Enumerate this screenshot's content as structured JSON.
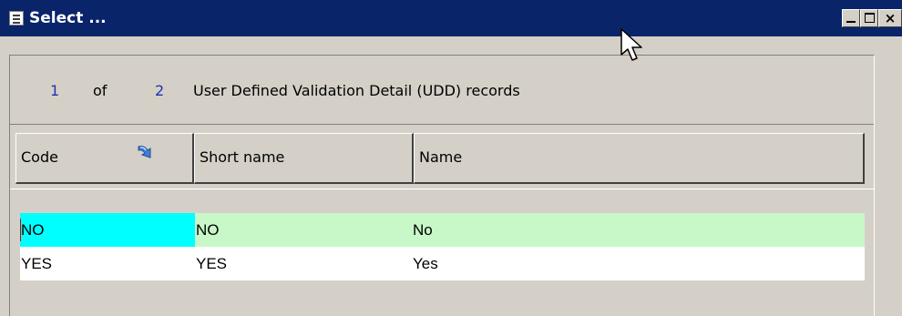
{
  "window": {
    "title": "Select ...",
    "colors": {
      "title_bar": "#0a246a",
      "face": "#d4d0c8",
      "selected_row": "#c8f8c8",
      "selected_cell": "#00ffff"
    },
    "icons": {
      "app": "app-icon",
      "minimize": "minimize-icon",
      "maximize": "maximize-icon",
      "close": "close-icon"
    },
    "close_glyph": "×"
  },
  "record_info": {
    "current": "1",
    "of_label": "of",
    "total": "2",
    "description": "User Defined Validation Detail (UDD) records"
  },
  "columns": [
    {
      "label": "Code",
      "sort_icon": "sort-arrow-icon"
    },
    {
      "label": "Short name"
    },
    {
      "label": "Name"
    }
  ],
  "rows": [
    {
      "code": "NO",
      "short_name": "NO",
      "name": "No",
      "selected": true
    },
    {
      "code": "YES",
      "short_name": "YES",
      "name": "Yes",
      "selected": false
    }
  ],
  "cursor_icon": "mouse-pointer-icon"
}
